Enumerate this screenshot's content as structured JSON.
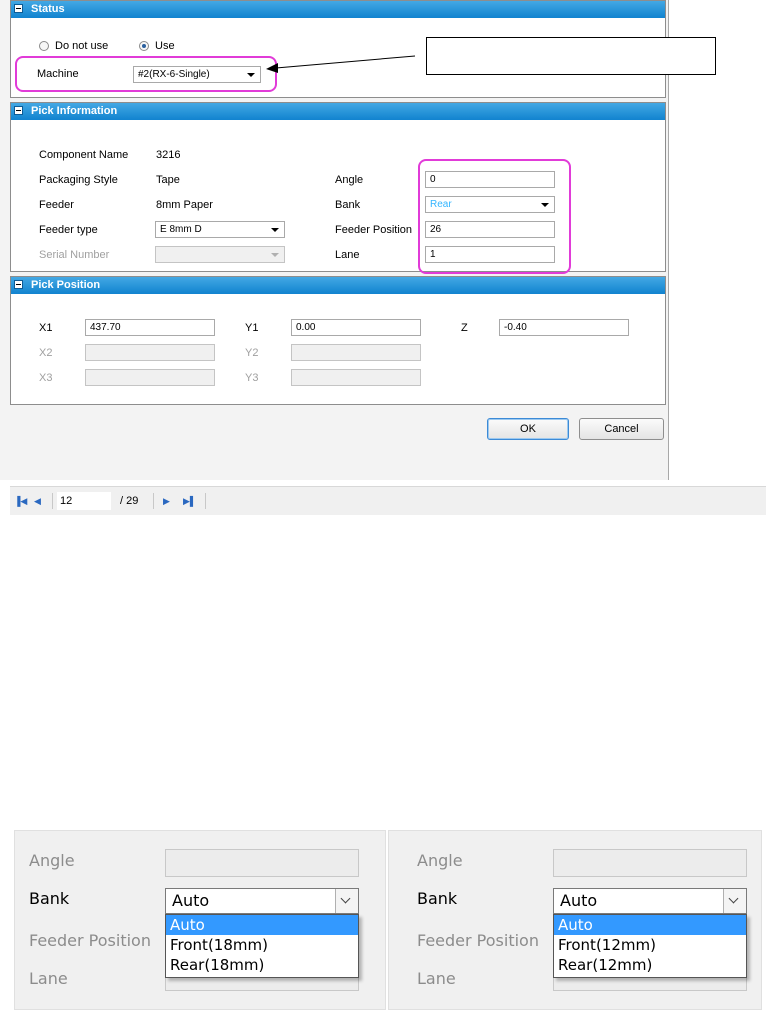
{
  "status": {
    "title": "Status",
    "radio_do_not_use": "Do not use",
    "radio_use": "Use",
    "machine_label": "Machine",
    "machine_value": "#2(RX-6-Single)",
    "callout_text": ""
  },
  "pick_info": {
    "title": "Pick Information",
    "component_name_label": "Component Name",
    "component_name_value": "3216",
    "packaging_style_label": "Packaging Style",
    "packaging_style_value": "Tape",
    "feeder_label": "Feeder",
    "feeder_value": "8mm Paper",
    "feeder_type_label": "Feeder type",
    "feeder_type_value": "E 8mm D",
    "serial_number_label": "Serial Number",
    "serial_number_value": "",
    "angle_label": "Angle",
    "angle_value": "0",
    "bank_label": "Bank",
    "bank_value": "Rear",
    "feeder_position_label": "Feeder Position",
    "feeder_position_value": "26",
    "lane_label": "Lane",
    "lane_value": "1"
  },
  "pick_position": {
    "title": "Pick Position",
    "x1_label": "X1",
    "x1_value": "437.70",
    "y1_label": "Y1",
    "y1_value": "0.00",
    "z_label": "Z",
    "z_value": "-0.40",
    "x2_label": "X2",
    "y2_label": "Y2",
    "x3_label": "X3",
    "y3_label": "Y3"
  },
  "buttons": {
    "ok": "OK",
    "cancel": "Cancel"
  },
  "navigator": {
    "current_page": "12",
    "total_pages": "/ 29",
    "first_icon": "first-page-icon",
    "prev_icon": "prev-page-icon",
    "next_icon": "next-page-icon",
    "last_icon": "last-page-icon"
  },
  "bank_dropdown_left": {
    "angle_label": "Angle",
    "bank_label": "Bank",
    "feeder_position_label": "Feeder Position",
    "lane_label": "Lane",
    "selected": "Auto",
    "options": [
      "Auto",
      "Front(18mm)",
      "Rear(18mm)"
    ]
  },
  "bank_dropdown_right": {
    "angle_label": "Angle",
    "bank_label": "Bank",
    "feeder_position_label": "Feeder Position",
    "lane_label": "Lane",
    "selected": "Auto",
    "options": [
      "Auto",
      "Front(12mm)",
      "Rear(12mm)"
    ]
  },
  "colors": {
    "section_header": "#1183cf",
    "highlight": "#e13bd8",
    "selected_option": "#3399ff",
    "bank_value_text": "#33b5ff"
  }
}
